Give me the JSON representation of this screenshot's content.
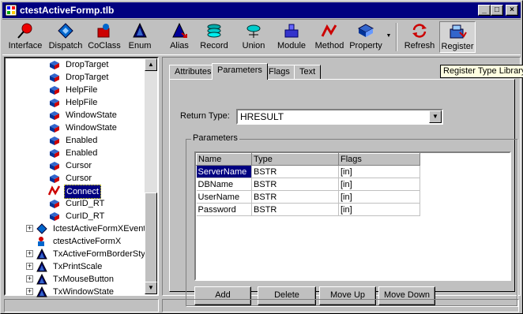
{
  "window": {
    "title": "ctestActiveFormp.tlb",
    "minimize": "_",
    "maximize": "□",
    "close": "×"
  },
  "toolbar": {
    "items": [
      {
        "label": "Interface",
        "icon": "interface-icon"
      },
      {
        "label": "Dispatch",
        "icon": "dispatch-icon"
      },
      {
        "label": "CoClass",
        "icon": "coclass-icon"
      },
      {
        "label": "Enum",
        "icon": "enum-icon"
      },
      {
        "label": "Alias",
        "icon": "alias-icon"
      },
      {
        "label": "Record",
        "icon": "record-icon"
      },
      {
        "label": "Union",
        "icon": "union-icon"
      },
      {
        "label": "Module",
        "icon": "module-icon"
      },
      {
        "label": "Method",
        "icon": "method-icon"
      },
      {
        "label": "Property",
        "icon": "property-icon"
      },
      {
        "label": "Refresh",
        "icon": "refresh-icon"
      },
      {
        "label": "Register",
        "icon": "register-icon"
      }
    ],
    "dropdown_arrow": "▼"
  },
  "tooltip": "Register Type Library",
  "tree": {
    "items": [
      {
        "label": "DropTarget"
      },
      {
        "label": "DropTarget"
      },
      {
        "label": "HelpFile"
      },
      {
        "label": "HelpFile"
      },
      {
        "label": "WindowState"
      },
      {
        "label": "WindowState"
      },
      {
        "label": "Enabled"
      },
      {
        "label": "Enabled"
      },
      {
        "label": "Cursor"
      },
      {
        "label": "Cursor"
      },
      {
        "label": "Connect"
      },
      {
        "label": "CurID_RT"
      },
      {
        "label": "CurID_RT"
      },
      {
        "label": "IctestActiveFormXEvents"
      },
      {
        "label": "ctestActiveFormX"
      },
      {
        "label": "TxActiveFormBorderStyle"
      },
      {
        "label": "TxPrintScale"
      },
      {
        "label": "TxMouseButton"
      },
      {
        "label": "TxWindowState"
      }
    ],
    "expander": "+",
    "scroll_up": "▲",
    "scroll_down": "▼"
  },
  "tabs": [
    "Attributes",
    "Parameters",
    "Flags",
    "Text"
  ],
  "active_tab": "Parameters",
  "return_type": {
    "label": "Return Type:",
    "value": "HRESULT",
    "arrow": "▼"
  },
  "parameters": {
    "group_label": "Parameters",
    "columns": [
      "Name",
      "Type",
      "Flags"
    ],
    "rows": [
      {
        "name": "ServerName",
        "type": "BSTR",
        "flags": "[in]"
      },
      {
        "name": "DBName",
        "type": "BSTR",
        "flags": "[in]"
      },
      {
        "name": "UserName",
        "type": "BSTR",
        "flags": "[in]"
      },
      {
        "name": "Password",
        "type": "BSTR",
        "flags": "[in]"
      }
    ],
    "buttons": {
      "add": "Add",
      "delete": "Delete",
      "move_up": "Move Up",
      "move_down": "Move Down"
    }
  }
}
